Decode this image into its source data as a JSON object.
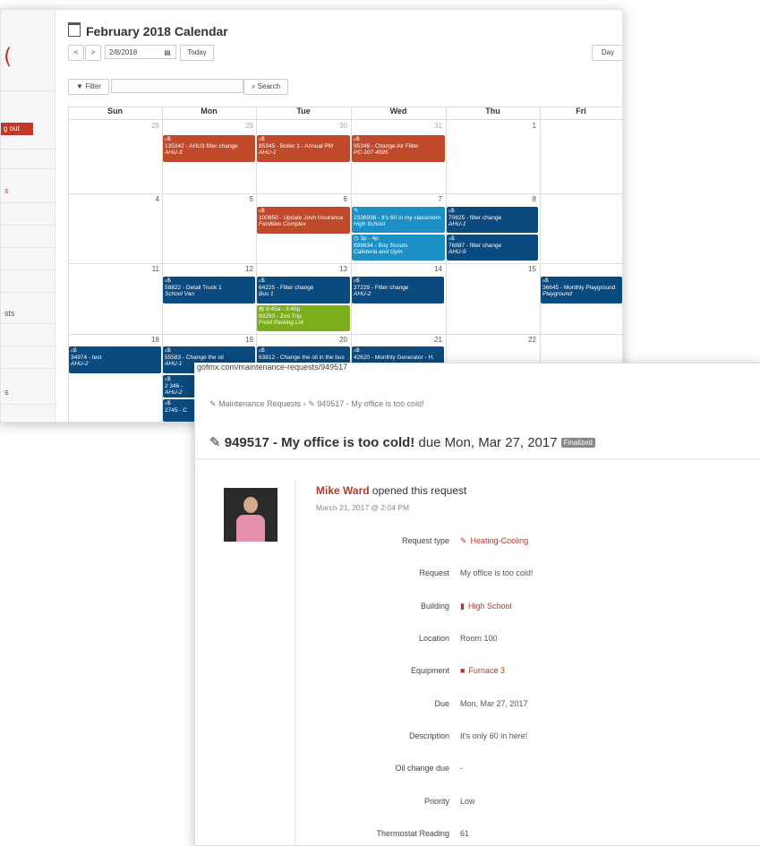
{
  "calendar": {
    "title": "February 2018 Calendar",
    "prev_label": "<",
    "next_label": ">",
    "date_value": "2/8/2018",
    "today_label": "Today",
    "day_label": "Day",
    "filter_label": "Filter",
    "search_label": "Search",
    "weekdays": [
      "Sun",
      "Mon",
      "Tue",
      "Wed",
      "Thu",
      "Fri"
    ],
    "week1": [
      "28",
      "29",
      "30",
      "31",
      "1"
    ],
    "week2": [
      "4",
      "5",
      "6",
      "7",
      "8"
    ],
    "week3": [
      "11",
      "12",
      "13",
      "14",
      "15"
    ],
    "week4": [
      "18",
      "19",
      "20",
      "21",
      "22"
    ],
    "events": {
      "e1": {
        "line1": "ℴ$",
        "line2": "135342 - AHU3 filter change",
        "line3": "AHU-3"
      },
      "e2": {
        "line1": "ℴ$",
        "line2": "85345 - Boiler 1 - Annual PM",
        "line3": "AHU-1"
      },
      "e3": {
        "line1": "ℴ$",
        "line2": "95346 - Change Air Filter",
        "line3": "PC-107-4595"
      },
      "e4": {
        "line1": "ℴ$",
        "line2": "100850 - Update Josh Insurance",
        "line3": "Facilities Complex"
      },
      "e5": {
        "line1": "✎",
        "line2": "2336936 - It's 60 in my classroom",
        "line3": "High School"
      },
      "e6": {
        "line1": "ℴ$",
        "line2": "70625 - filter change",
        "line3": "AHU-1"
      },
      "e7": {
        "line1": "◷ 3p - 4p",
        "line2": "899634 - Boy Scouts",
        "line3": "Cafeteria and Gym"
      },
      "e8": {
        "line1": "ℴ$",
        "line2": "76887 - filter change",
        "line3": "AHU-9"
      },
      "e9": {
        "line1": "ℴ$",
        "line2": "58822 - Detail Truck 1",
        "line3": "School Van"
      },
      "e10": {
        "line1": "ℴ$",
        "line2": "64225 - Filter change",
        "line3": "Bus 1"
      },
      "e11": {
        "line1": "ℴ$",
        "line2": "27229 - Filter change",
        "line3": "AHU-2"
      },
      "e12": {
        "line1": "ℴ$",
        "line2": "36645 - Monthly Playground",
        "line3": "Playground"
      },
      "e13": {
        "line1": "▤ 8:45a - 3:45p",
        "line2": "90250 - Zoo Trip",
        "line3": "Front Parking Lot"
      },
      "e14": {
        "line1": "ℴ$",
        "line2": "34974 - test",
        "line3": "AHU-2"
      },
      "e15": {
        "line1": "ℴ$",
        "line2": "55583 - Change the oil",
        "line3": "AHU-1"
      },
      "e16": {
        "line1": "ℴ$",
        "line2": "63812 - Change the oil in the bus",
        "line3": ""
      },
      "e17": {
        "line1": "ℴ$",
        "line2": "42620 - Monthly Generator - H.",
        "line3": ""
      },
      "e18": {
        "line1": "ℴ$",
        "line2": "2 346 - ",
        "line3": "AHU-2"
      },
      "e19": {
        "line1": "ℴ$",
        "line2": "2745 - C",
        "line3": ""
      }
    }
  },
  "sidebar": {
    "logout_label": "g out",
    "item_a": "s",
    "item_b": "sts",
    "item_c": "s"
  },
  "request": {
    "url": "gofmx.com/maintenance-requests/949517",
    "breadcrumb_root": "Maintenance Requests",
    "breadcrumb_sep": "›",
    "breadcrumb_current": "949517 - My office is too cold!",
    "title_bold": "949517 - My office is too cold!",
    "title_due": "due Mon, Mar 27, 2017",
    "status_badge": "Finalized",
    "opener_name": "Mike Ward",
    "opener_action": "opened this request",
    "opened_at": "March 21, 2017 @ 2:04 PM",
    "fields": [
      {
        "label": "Request type",
        "value": "Heating-Cooling"
      },
      {
        "label": "Request",
        "value": "My office is too cold!"
      },
      {
        "label": "Building",
        "value": "High School"
      },
      {
        "label": "Location",
        "value": "Room 100"
      },
      {
        "label": "Equipment",
        "value": "Furnace 3"
      },
      {
        "label": "Due",
        "value": "Mon, Mar 27, 2017"
      },
      {
        "label": "Description",
        "value": "It's only 60 in here!"
      },
      {
        "label": "Oil change due",
        "value": "-"
      },
      {
        "label": "Priority",
        "value": "Low"
      },
      {
        "label": "Thermostat Reading",
        "value": "61"
      }
    ]
  },
  "colors": {
    "accent_red": "#b0392b",
    "event_orange": "#c0492c",
    "event_navy": "#0b4a7e",
    "event_teal": "#1b8fc6",
    "event_green": "#7cae1c"
  }
}
